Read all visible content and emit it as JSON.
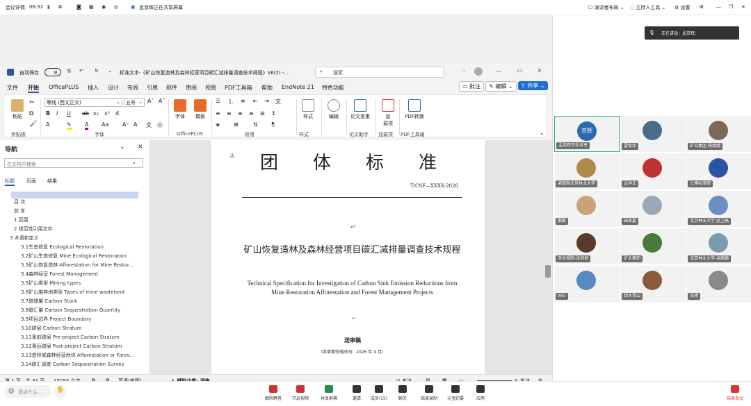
{
  "meeting": {
    "info_label": "会议详情",
    "time": "06:32",
    "sharing_text": "孟京辉正在共享屏幕",
    "presenter_layout": "演讲者布局",
    "host_tools": "主持人工具",
    "settings": "设置",
    "speaking": "正在讲话：孟京辉;"
  },
  "word": {
    "autosave": "自动保存",
    "autosave_state": "关",
    "doc_title": "标准文本-《矿山恢复造林及森林经营项目碳汇减排量调查技术规程》V6(2) -...",
    "search_placeholder": "搜索",
    "menu": [
      "文件",
      "开始",
      "OfficePLUS",
      "插入",
      "设计",
      "布局",
      "引用",
      "邮件",
      "审阅",
      "视图",
      "PDF工具箱",
      "帮助",
      "EndNote 21",
      "特色功能"
    ],
    "comment_btn": "批注",
    "edit_btn": "编辑",
    "share_btn": "共享",
    "ribbon": {
      "paste": "粘贴",
      "clipboard": "剪贴板",
      "font_name": "等线 (西文正文)",
      "font_size": "五号",
      "font": "字体",
      "font_btn": "字体",
      "template": "模板",
      "officeplus": "OfficePLUS",
      "paragraph": "段落",
      "style": "样式",
      "style_grp": "样式",
      "editing": "编辑",
      "paper_check": "论文查重",
      "paper_assist": "论文助手",
      "addins": "加\n载项",
      "addins_grp": "加载项",
      "pdf_convert": "PDF转换",
      "pdf_tools": "PDF工具箱"
    },
    "nav": {
      "title": "导航",
      "search_placeholder": "在文档中搜索",
      "tabs": [
        "标题",
        "页面",
        "结果"
      ],
      "items": [
        "目 次",
        "前 言",
        "1 范围",
        "2 规范性引用文件",
        "3 术语和定义",
        "3.1生态修复 Ecological Restoration",
        "3.2矿山生态修复 Mine Ecological Restoration",
        "3.3矿山恢复造林 Afforestation for Mine Restor...",
        "3.4森林经营 Forest Management",
        "3.5矿山类型 Mining types",
        "3.6矿山废弃地类型 Types of mine wasteland",
        "3.7碳储量 Carbon Stock",
        "3.8碳汇量 Carbon Sequestration Quantity",
        "3.9项目边界 Project Boundary",
        "3.10碳层 Carbon Stratum",
        "3.11事前碳层 Pre-project Carbon Stratum",
        "3.12事后碳层 Post-project Carbon Stratum",
        "3.13造林或森林经营地块 Afforestation or Fores...",
        "3.14碳汇调查 Carbon Sequestration Survey"
      ]
    },
    "doc": {
      "header": "团　体　标　准",
      "code": "T/CSF—XXXX-2026",
      "title_cn": "矿山恢复造林及森林经营项目碳汇减排量调查技术规程",
      "title_en": "Technical Specification for Investigation of Carbon Sink Emission Reductions from Mine Restoration Afforestation and Forest Management Projects",
      "draft": "送审稿",
      "date": "（本草案完成时间：2026 年 4 月）"
    },
    "status": {
      "page": "第 1 页，共 31 页",
      "words": "15055 个字",
      "lang": "英语(美国)",
      "accessibility": "辅助功能: 调查",
      "focus": "专注",
      "comment": "批注"
    }
  },
  "participants": [
    {
      "name": "孟京辉正在共享",
      "avatar": "京辉",
      "color": "#2b6cb0"
    },
    {
      "name": "雷俊伟",
      "color": "#4a6b8a"
    },
    {
      "name": "矿冶集团-杨婧婧",
      "color": "#7a6a5a"
    },
    {
      "name": "梁智胜北京林业大学",
      "color": "#b08a4a"
    },
    {
      "name": "孟祥江",
      "color": "#b33"
    },
    {
      "name": "土壤标准部",
      "color": "#2a55a5"
    },
    {
      "name": "鹏鹏",
      "color": "#c9a27a"
    },
    {
      "name": "田本嘉",
      "color": "#9aa8b8"
    },
    {
      "name": "北京林业大学-赵卫高",
      "color": "#6a8fc0"
    },
    {
      "name": "深水规院-张浩君",
      "color": "#5a3a2a"
    },
    {
      "name": "矿业集团",
      "color": "#4a7a3a"
    },
    {
      "name": "北京林业大学-张鹏鹏",
      "color": "#7a9ab0"
    },
    {
      "name": "WEI",
      "color": "#5a8ac0"
    },
    {
      "name": "绿水青山",
      "color": "#8a5a3a"
    },
    {
      "name": "张博",
      "color": "#8a8a8a"
    }
  ],
  "toolbar": [
    "解除静音",
    "开启视频",
    "共享屏幕",
    "邀请",
    "成员(15)",
    "聊天",
    "结束录制",
    "元宝纪要",
    "应用"
  ],
  "chat_placeholder": "说点什么...",
  "end_meeting": "结束会议"
}
